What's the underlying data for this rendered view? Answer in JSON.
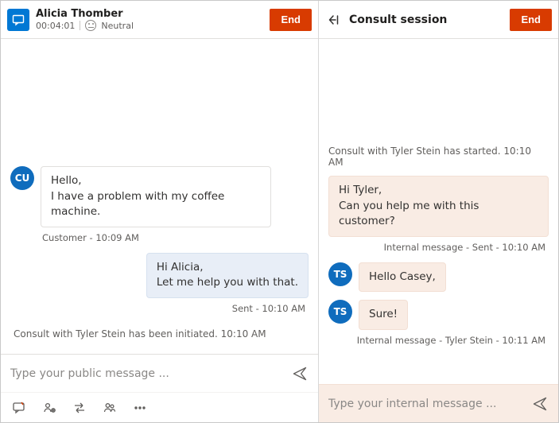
{
  "left": {
    "customer_name": "Alicia Thomber",
    "duration": "00:04:01",
    "sentiment_label": "Neutral",
    "end_label": "End",
    "customer_initials": "CU",
    "messages": {
      "m1_line1": "Hello,",
      "m1_line2": "I have a problem with my coffee machine.",
      "m1_meta": "Customer - 10:09 AM",
      "m2_line1": "Hi Alicia,",
      "m2_line2": "Let me help you with that.",
      "m2_meta": "Sent - 10:10 AM"
    },
    "system_line": "Consult with Tyler Stein has been initiated. 10:10 AM",
    "input_placeholder": "Type your public message ..."
  },
  "right": {
    "title": "Consult session",
    "end_label": "End",
    "peer_initials": "TS",
    "system_top": "Consult with Tyler Stein has started. 10:10 AM",
    "messages": {
      "m1_line1": "Hi Tyler,",
      "m1_line2": "Can you help me with this customer?",
      "m1_meta": "Internal message - Sent - 10:10 AM",
      "m2_text": "Hello Casey,",
      "m3_text": "Sure!",
      "m3_meta": "Internal message - Tyler Stein - 10:11 AM"
    },
    "input_placeholder": "Type your internal message ..."
  },
  "icons": {
    "chat": "chat-icon",
    "back": "back-arrow-icon",
    "send": "send-icon",
    "quick_replies": "quick-replies-icon",
    "consult": "consult-icon",
    "transfer": "transfer-icon",
    "people": "people-icon",
    "more": "more-icon"
  }
}
